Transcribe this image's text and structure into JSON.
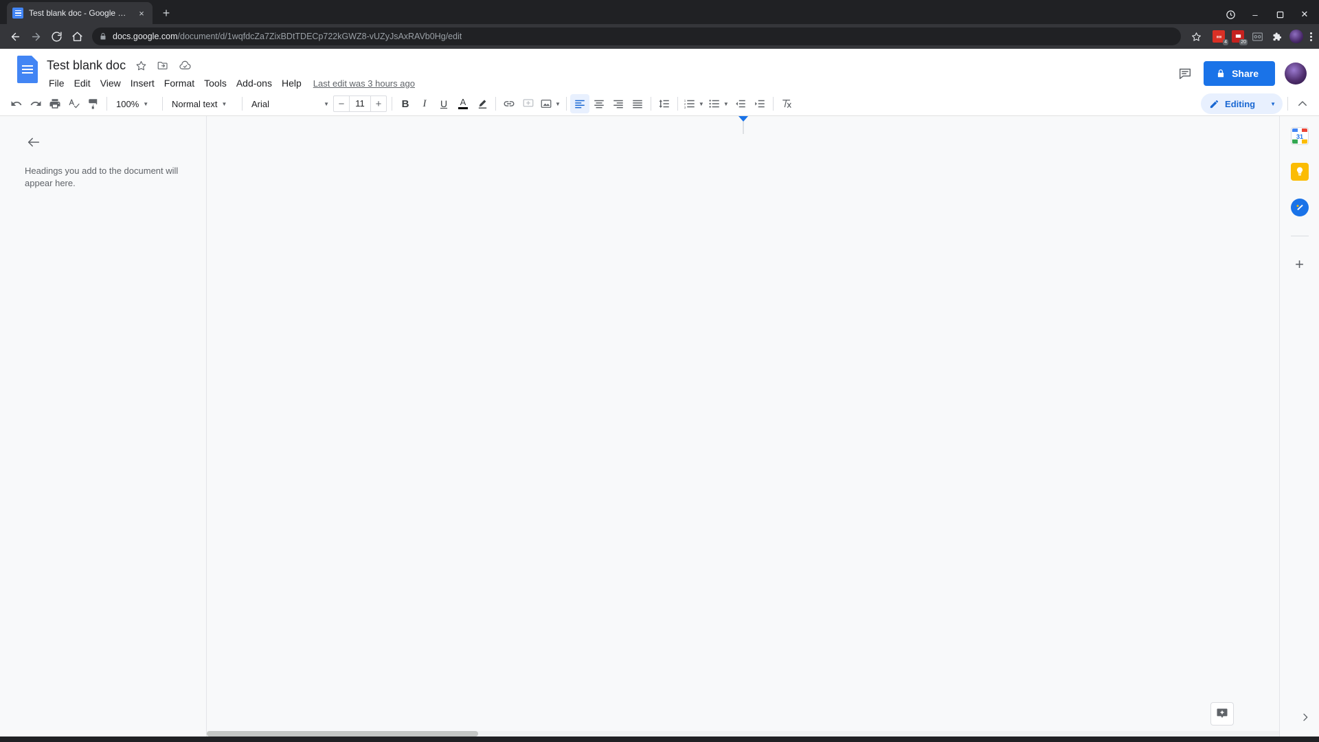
{
  "browser": {
    "tab": {
      "title": "Test blank doc - Google Docs",
      "favicon_name": "google-docs-favicon",
      "close_label": "×"
    },
    "new_tab_label": "+",
    "window_controls": {
      "minimize": "–",
      "maximize": "❐",
      "close": "✕"
    },
    "nav": {
      "back": "←",
      "forward": "→",
      "reload": "↻",
      "home": "⌂"
    },
    "omnibox": {
      "lock_icon": "lock-icon",
      "url_domain": "docs.google.com",
      "url_path": "/document/d/1wqfdcZa7ZixBDtTDECp722kGWZ8-vUZyJsAxRAVb0Hg/edit",
      "bookmark_icon": "star-icon"
    },
    "extensions": [
      {
        "name": "extension-red-1",
        "badge": "4",
        "color": "#d93025"
      },
      {
        "name": "extension-red-2",
        "badge": "20",
        "color": "#c5221f"
      },
      {
        "name": "extension-grid",
        "badge": "",
        "color": "#3c4043"
      },
      {
        "name": "extensions-puzzle-icon",
        "badge": "",
        "color": "#e8eaed"
      }
    ],
    "profile_avatar": "profile-avatar",
    "menu_icon": "browser-menu-icon"
  },
  "docs": {
    "logo_name": "google-docs-logo",
    "title": "Test blank doc",
    "title_icons": [
      {
        "name": "star-icon",
        "glyph": "☆"
      },
      {
        "name": "move-to-folder-icon",
        "glyph": "folder"
      },
      {
        "name": "saved-to-drive-icon",
        "glyph": "cloud"
      }
    ],
    "menus": [
      "File",
      "Edit",
      "View",
      "Insert",
      "Format",
      "Tools",
      "Add-ons",
      "Help"
    ],
    "last_edit": "Last edit was 3 hours ago",
    "header_right": {
      "comment_history_icon": "comment-history-icon",
      "share_label": "Share",
      "share_lock_icon": "lock-icon",
      "share_color": "#1a73e8",
      "avatar_name": "user-avatar"
    },
    "toolbar": {
      "undo": "undo-icon",
      "redo": "redo-icon",
      "print": "print-icon",
      "spelling": "spellcheck-icon",
      "paint_format": "paint-format-icon",
      "zoom_value": "100%",
      "style_value": "Normal text",
      "font_value": "Arial",
      "font_size_value": "11",
      "font_size_decrease": "−",
      "font_size_increase": "+",
      "bold": "B",
      "italic": "I",
      "underline": "U",
      "text_color": "A",
      "highlight": "highlight-icon",
      "insert_link": "link-icon",
      "add_comment": "add-comment-icon",
      "insert_image": "insert-image-icon",
      "align_left": "align-left-icon",
      "align_center": "align-center-icon",
      "align_right": "align-right-icon",
      "align_justify": "align-justify-icon",
      "line_spacing": "line-spacing-icon",
      "numbered_list": "numbered-list-icon",
      "bulleted_list": "bulleted-list-icon",
      "decrease_indent": "decrease-indent-icon",
      "increase_indent": "increase-indent-icon",
      "clear_formatting": "clear-formatting-icon",
      "mode_label": "Editing",
      "mode_icon": "pencil-icon",
      "mode_accent": "#1967d2",
      "hide_menus_icon": "chevron-up-icon"
    },
    "outline": {
      "back_icon": "back-arrow-icon",
      "hint": "Headings you add to the document will appear here."
    },
    "right_rail": [
      {
        "name": "google-calendar-icon",
        "label": "31",
        "color": "#1a73e8"
      },
      {
        "name": "google-keep-icon",
        "label": "",
        "color": "#fbbc04"
      },
      {
        "name": "google-tasks-icon",
        "label": "",
        "color": "#1a73e8"
      }
    ],
    "rail_add_label": "+",
    "rail_expand_icon": "chevron-right-icon",
    "explore_icon": "explore-icon"
  }
}
